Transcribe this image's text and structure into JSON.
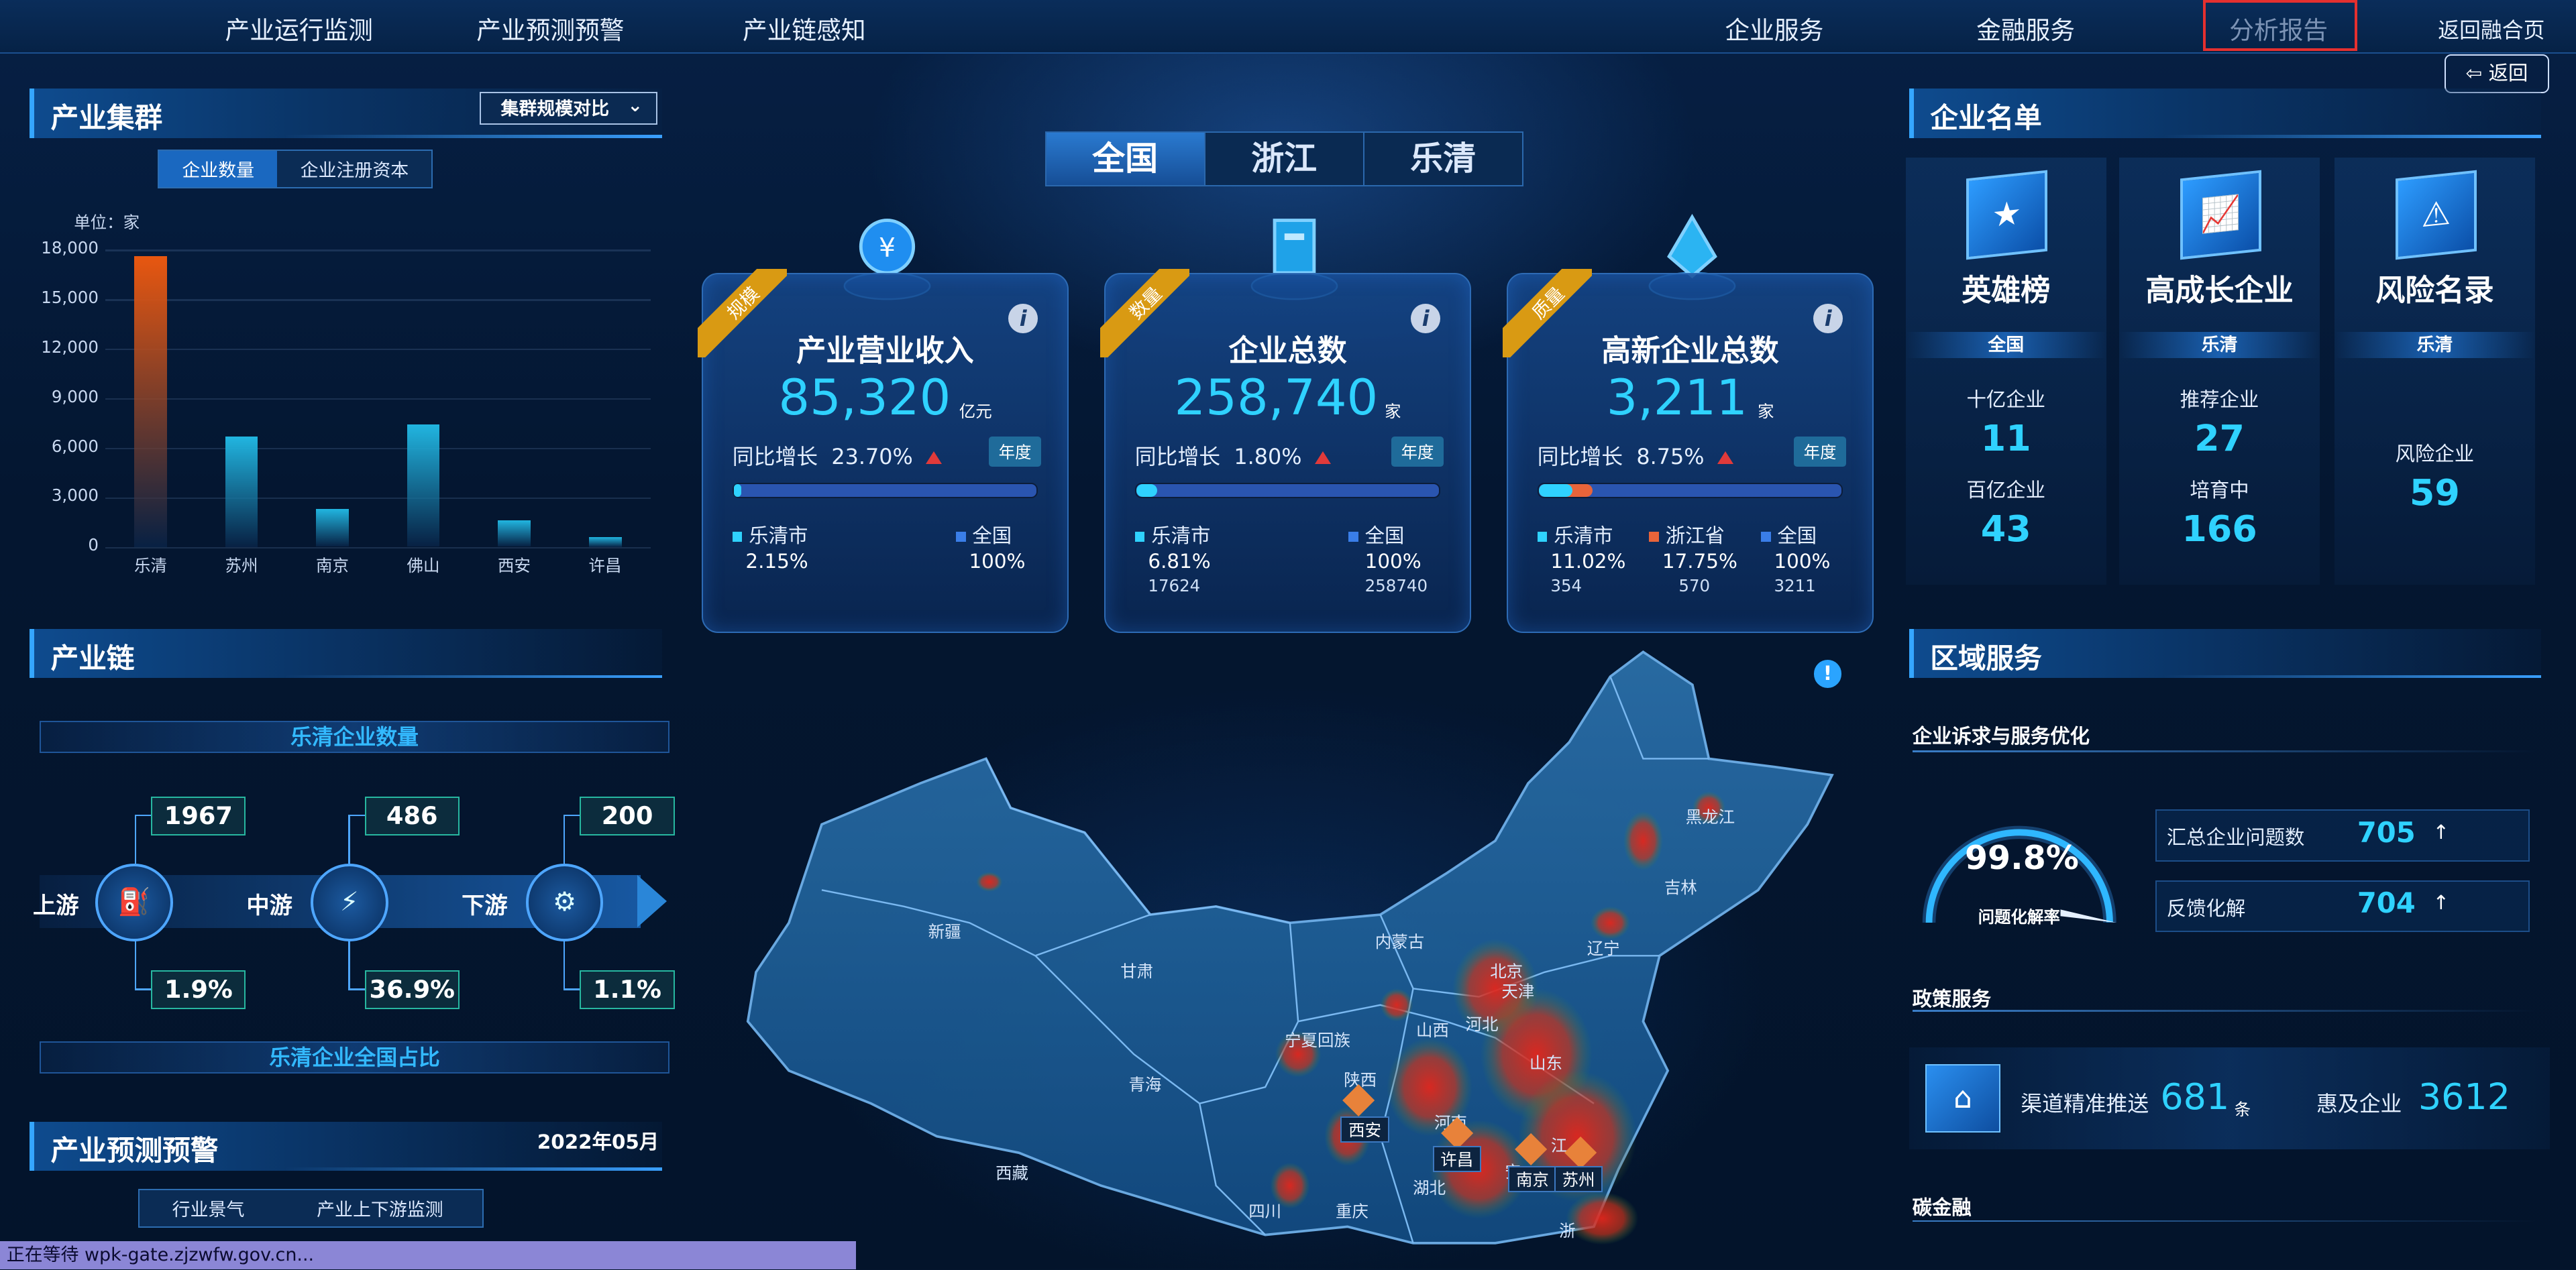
{
  "nav": {
    "left": [
      "产业运行监测",
      "产业预测预警",
      "产业链感知"
    ],
    "right": [
      "企业服务",
      "金融服务",
      "分析报告",
      "返回融合页"
    ],
    "back_label": "返回"
  },
  "cluster": {
    "title": "产业集群",
    "compare_label": "集群规模对比",
    "tabs": [
      "企业数量",
      "企业注册资本"
    ],
    "unit": "单位：家"
  },
  "chart_data": {
    "type": "bar",
    "title": "",
    "ylabel": "单位：家",
    "categories": [
      "乐清",
      "苏州",
      "南京",
      "佛山",
      "西安",
      "许昌"
    ],
    "values": [
      17600,
      6700,
      2300,
      7400,
      1600,
      600
    ],
    "ylim": [
      0,
      18000
    ],
    "yticks": [
      "0",
      "3,000",
      "6,000",
      "9,000",
      "12,000",
      "15,000",
      "18,000"
    ],
    "colors": [
      "#e85710",
      "#21b5e0",
      "#21b5e0",
      "#21b5e0",
      "#21b5e0",
      "#21b5e0"
    ],
    "grid": true
  },
  "chain": {
    "title": "产业链",
    "count_title": "乐清企业数量",
    "share_title": "乐清企业全国占比",
    "stages": [
      {
        "label": "上游",
        "count": "1967",
        "share": "1.9%"
      },
      {
        "label": "中游",
        "count": "486",
        "share": "36.9%"
      },
      {
        "label": "下游",
        "count": "200",
        "share": "1.1%"
      }
    ]
  },
  "forecast": {
    "title": "产业预测预警",
    "date": "2022年05月",
    "tabs": [
      "行业景气",
      "产业上下游监测"
    ]
  },
  "region_tabs": [
    "全国",
    "浙江",
    "乐清"
  ],
  "cards": [
    {
      "ribbon": "规模",
      "title": "产业营业收入",
      "value": "85,320",
      "unit": "亿元",
      "yoy_label": "同比增长",
      "yoy": "23.70%",
      "period": "年度",
      "progress": 0.0215,
      "legend": [
        {
          "name": "乐清市",
          "color": "#2fd2ff",
          "pct": "2.15%",
          "count": ""
        },
        {
          "name": "全国",
          "color": "#3a7ee8",
          "pct": "100%",
          "count": ""
        }
      ]
    },
    {
      "ribbon": "数量",
      "title": "企业总数",
      "value": "258,740",
      "unit": "家",
      "yoy_label": "同比增长",
      "yoy": "1.80%",
      "period": "年度",
      "progress": 0.0681,
      "legend": [
        {
          "name": "乐清市",
          "color": "#2fd2ff",
          "pct": "6.81%",
          "count": "17624"
        },
        {
          "name": "全国",
          "color": "#3a7ee8",
          "pct": "100%",
          "count": "258740"
        }
      ]
    },
    {
      "ribbon": "质量",
      "title": "高新企业总数",
      "value": "3,211",
      "unit": "家",
      "yoy_label": "同比增长",
      "yoy": "8.75%",
      "period": "年度",
      "progress": 0.1102,
      "progress2": 0.1775,
      "legend": [
        {
          "name": "乐清市",
          "color": "#2fd2ff",
          "pct": "11.02%",
          "count": "354"
        },
        {
          "name": "浙江省",
          "color": "#e8643a",
          "pct": "17.75%",
          "count": "570"
        },
        {
          "name": "全国",
          "color": "#3a7ee8",
          "pct": "100%",
          "count": "3211"
        }
      ]
    }
  ],
  "map": {
    "provinces": [
      "黑龙江",
      "吉林",
      "辽宁",
      "内蒙古",
      "北京",
      "天津",
      "河北",
      "山西",
      "山东",
      "新疆",
      "甘肃",
      "宁夏回族",
      "陕西",
      "青海",
      "西藏",
      "河南",
      "湖北",
      "江",
      "安",
      "四川",
      "重庆",
      "浙"
    ],
    "cities": [
      "西安",
      "许昌",
      "南京",
      "苏州"
    ]
  },
  "enterprise": {
    "title": "企业名单",
    "cols": [
      {
        "title": "英雄榜",
        "scope": "全国",
        "icon": "star-icon",
        "items": [
          {
            "label": "十亿企业",
            "value": "11"
          },
          {
            "label": "百亿企业",
            "value": "43"
          }
        ]
      },
      {
        "title": "高成长企业",
        "scope": "乐清",
        "icon": "growth-chart-icon",
        "items": [
          {
            "label": "推荐企业",
            "value": "27"
          },
          {
            "label": "培育中",
            "value": "166"
          }
        ]
      },
      {
        "title": "风险名录",
        "scope": "乐清",
        "icon": "warning-icon",
        "items": [
          {
            "label": "风险企业",
            "value": "59"
          }
        ]
      }
    ]
  },
  "region_service": {
    "title": "区域服务",
    "appeal_title": "企业诉求与服务优化",
    "gauge_value": "99.8%",
    "gauge_label": "问题化解率",
    "gauge_fraction": 0.998,
    "rows": [
      {
        "label": "汇总企业问题数",
        "value": "705",
        "arrow": "↑"
      },
      {
        "label": "反馈化解",
        "value": "704",
        "arrow": "↑"
      }
    ],
    "policy_title": "政策服务",
    "policy": {
      "push_label": "渠道精准推送",
      "push_value": "681",
      "push_unit": "条",
      "benefit_label": "惠及企业",
      "benefit_value": "3612"
    },
    "finance_title": "碳金融"
  },
  "status_bar": "正在等待 wpk-gate.zjzwfw.gov.cn..."
}
